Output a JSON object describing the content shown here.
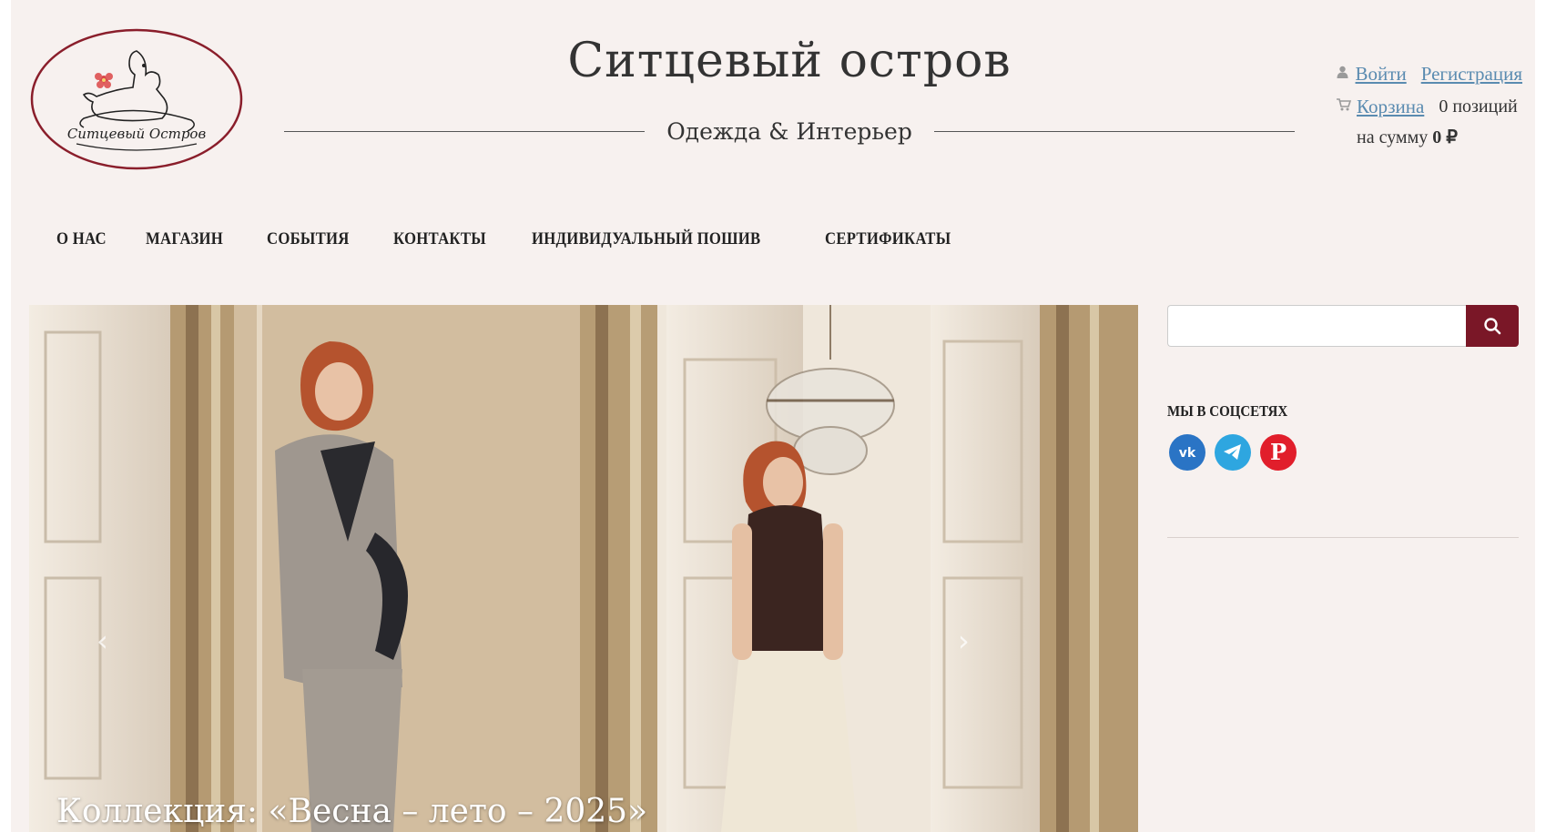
{
  "header": {
    "logo_text": "Ситцевый Остров",
    "title": "Ситцевый остров",
    "subtitle": "Одежда & Интерьер"
  },
  "user": {
    "login": "Войти",
    "register": "Регистрация",
    "cart": "Корзина",
    "cart_count": "0 позиций",
    "sum_label": "на сумму",
    "sum_value": "0 ₽",
    "icons": [
      "user-icon",
      "cart-icon"
    ]
  },
  "nav": {
    "items": [
      "О НАС",
      "МАГАЗИН",
      "СОБЫТИЯ",
      "КОНТАКТЫ",
      "ИНДИВИДУАЛЬНЫЙ ПОШИВ",
      "СЕРТИФИКАТЫ"
    ]
  },
  "hero": {
    "caption": "Коллекция: «Весна – лето – 2025»",
    "prev": "‹",
    "next": "›"
  },
  "search": {
    "placeholder": "",
    "value": ""
  },
  "social": {
    "title": "МЫ В СОЦСЕТЯХ",
    "networks": [
      {
        "name": "vk-icon",
        "color": "#2a74c5"
      },
      {
        "name": "telegram-icon",
        "color": "#2ea6e0"
      },
      {
        "name": "pinterest-icon",
        "color": "#e11e2b"
      }
    ]
  },
  "colors": {
    "accent": "#7a1727",
    "link": "#5a8bb0",
    "page_bg": "#f7f1ef"
  }
}
